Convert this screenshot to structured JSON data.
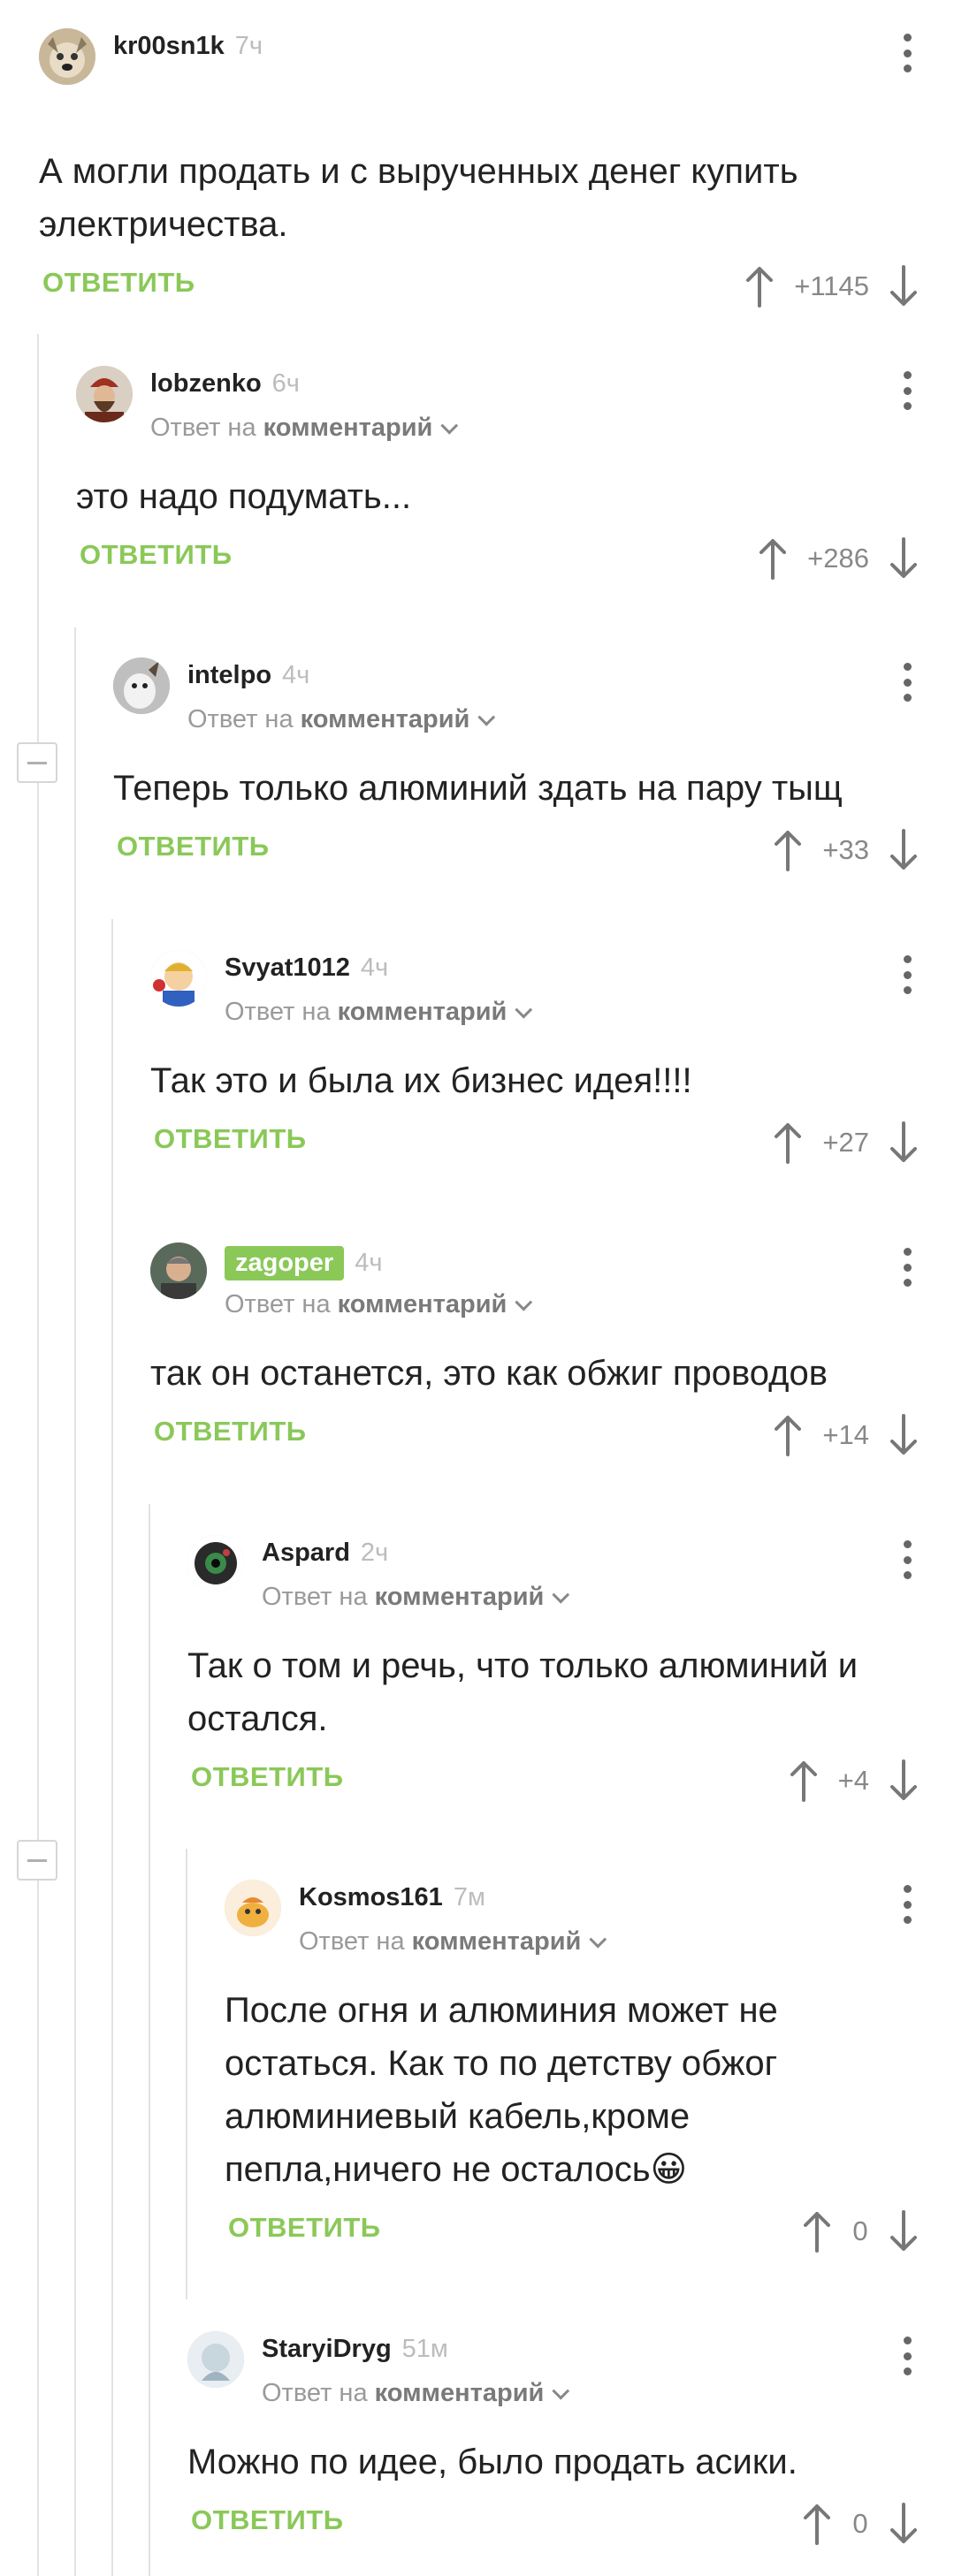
{
  "accent_color": "#8ac858",
  "comments": [
    {
      "username": "kr00sn1k",
      "time": "7ч",
      "text": "А могли продать и с вырученных денег купить электричества.",
      "reply_label": "ОТВЕТИТЬ",
      "score": "+1145",
      "avatar_icon": "dog-avatar"
    },
    {
      "username": "lobzenko",
      "time": "6ч",
      "reply_prefix": "Ответ на",
      "reply_target": "комментарий",
      "text": "это надо подумать...",
      "reply_label": "ОТВЕТИТЬ",
      "score": "+286",
      "avatar_icon": "tsar-avatar"
    },
    {
      "username": "intelpo",
      "time": "4ч",
      "reply_prefix": "Ответ на",
      "reply_target": "комментарий",
      "text": "Теперь только алюминий здать на пару тыщ",
      "reply_label": "ОТВЕТИТЬ",
      "score": "+33",
      "avatar_icon": "animal-avatar"
    },
    {
      "username": "Svyat1012",
      "time": "4ч",
      "reply_prefix": "Ответ на",
      "reply_target": "комментарий",
      "text": "Так это и была их бизнес идея!!!!",
      "reply_label": "ОТВЕТИТЬ",
      "score": "+27",
      "avatar_icon": "vault-boy-avatar"
    },
    {
      "username": "zagoper",
      "time": "4ч",
      "reply_prefix": "Ответ на",
      "reply_target": "комментарий",
      "text": "так он останется, это как обжиг проводов",
      "reply_label": "ОТВЕТИТЬ",
      "score": "+14",
      "avatar_icon": "man-avatar"
    },
    {
      "username": "Aspard",
      "time": "2ч",
      "reply_prefix": "Ответ на",
      "reply_target": "комментарий",
      "text": "Так о том и речь, что только алюминий и остался.",
      "reply_label": "ОТВЕТИТЬ",
      "score": "+4",
      "avatar_icon": "robot-avatar"
    },
    {
      "username": "Kosmos161",
      "time": "7м",
      "reply_prefix": "Ответ на",
      "reply_target": "комментарий",
      "text": "После огня и алюминия может не остаться. Как то по детству обжог алюминиевый кабель,кроме пепла,ничего не осталось😀",
      "reply_label": "ОТВЕТИТЬ",
      "score": "0",
      "avatar_icon": "cartoon-avatar"
    },
    {
      "username": "StaryiDryg",
      "time": "51м",
      "reply_prefix": "Ответ на",
      "reply_target": "комментарий",
      "text": "Можно по идее, было продать асики.",
      "reply_label": "ОТВЕТИТЬ",
      "score": "0",
      "avatar_icon": "light-avatar"
    }
  ]
}
